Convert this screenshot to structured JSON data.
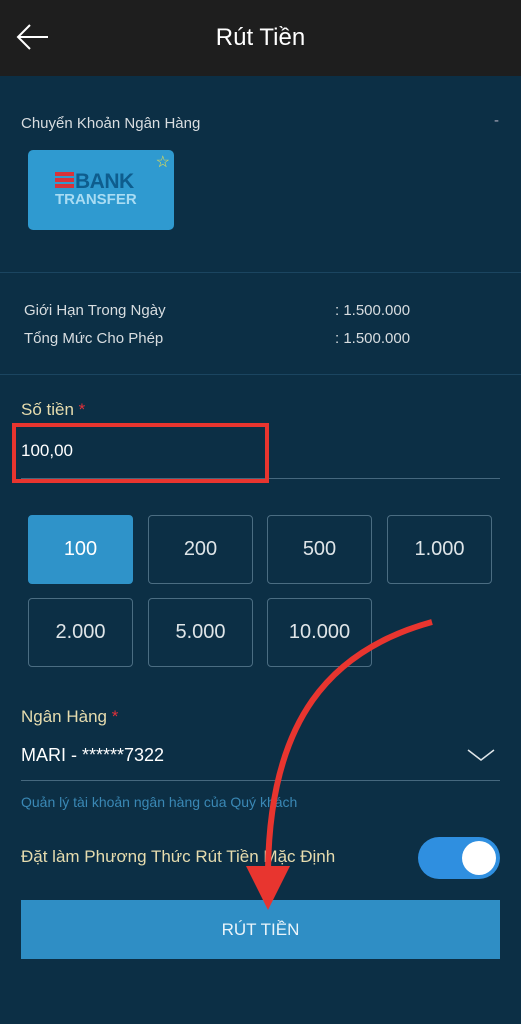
{
  "header": {
    "title": "Rút Tiền",
    "back_icon": "arrow-left-icon"
  },
  "method": {
    "label": "Chuyển Khoản Ngân Hàng",
    "collapse": "-",
    "card_line1": "BANK",
    "card_line2": "TRANSFER"
  },
  "limits": [
    {
      "label": "Giới Hạn Trong Ngày",
      "value": ": 1.500.000"
    },
    {
      "label": "Tổng Mức Cho Phép",
      "value": ": 1.500.000"
    }
  ],
  "amount": {
    "label": "Số tiền",
    "required": "*",
    "value": "100,00"
  },
  "presets": [
    {
      "label": "100",
      "active": true
    },
    {
      "label": "200"
    },
    {
      "label": "500"
    },
    {
      "label": "1.000"
    },
    {
      "label": "2.000"
    },
    {
      "label": "5.000"
    },
    {
      "label": "10.000"
    }
  ],
  "bank": {
    "label": "Ngân Hàng",
    "required": "*",
    "value": "MARI - ******7322",
    "manage_link": "Quản lý tài khoản ngân hàng của Quý khách"
  },
  "default_method": {
    "label": "Đặt làm Phương Thức Rút Tiền Mặc Định",
    "enabled": true
  },
  "submit_label": "RÚT TIỀN",
  "colors": {
    "background": "#0c2f45",
    "accent": "#2f93c9",
    "annotation": "#e8352f"
  }
}
